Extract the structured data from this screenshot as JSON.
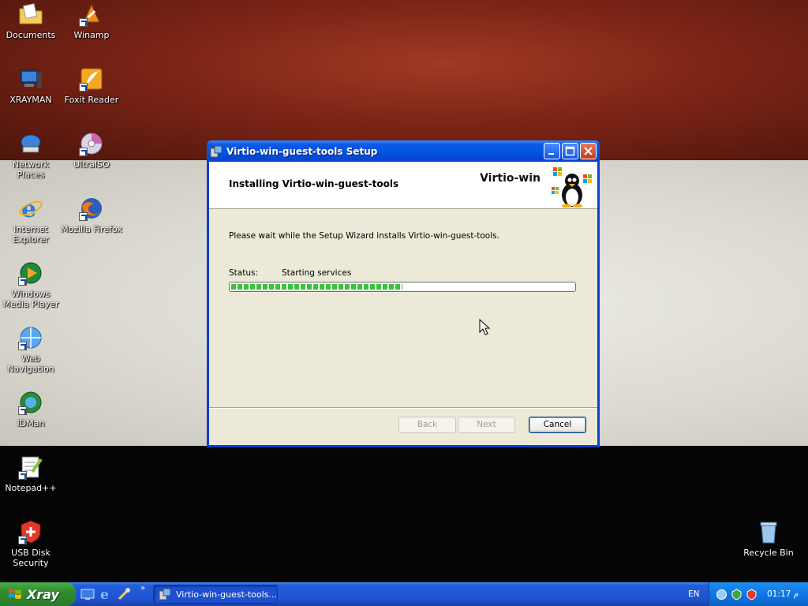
{
  "desktop": {
    "icons": [
      {
        "label": "Documents",
        "icon": "folder-documents-icon"
      },
      {
        "label": "Winamp",
        "icon": "winamp-icon"
      },
      {
        "label": "XRAYMAN",
        "icon": "computer-icon"
      },
      {
        "label": "Foxit Reader",
        "icon": "foxit-reader-icon"
      },
      {
        "label": "Network Places",
        "icon": "network-places-icon"
      },
      {
        "label": "UltraISO",
        "icon": "ultraiso-icon"
      },
      {
        "label": "Internet Explorer",
        "icon": "internet-explorer-icon"
      },
      {
        "label": "Mozilla Firefox",
        "icon": "firefox-icon"
      },
      {
        "label": "Windows Media Player",
        "icon": "media-player-icon"
      },
      {
        "label": "Web Navigation",
        "icon": "web-navigation-icon"
      },
      {
        "label": "IDMan",
        "icon": "idman-icon"
      },
      {
        "label": "Notepad++",
        "icon": "notepad-plus-plus-icon"
      },
      {
        "label": "USB Disk Security",
        "icon": "usb-disk-security-icon"
      },
      {
        "label": "Recycle Bin",
        "icon": "recycle-bin-icon"
      }
    ]
  },
  "window": {
    "title": "Virtio-win-guest-tools Setup",
    "banner_title": "Installing Virtio-win-guest-tools",
    "brand": "Virtio-win",
    "message": "Please wait while the Setup Wizard installs Virtio-win-guest-tools.",
    "status_label": "Status:",
    "status_value": "Starting services",
    "progress_fraction": 0.5,
    "buttons": {
      "back": "Back",
      "next": "Next",
      "cancel": "Cancel"
    }
  },
  "taskbar": {
    "start_label": "Xray",
    "more": "»",
    "task_label": "Virtio-win-guest-tools...",
    "language": "EN",
    "clock": "01:17 م"
  },
  "colors": {
    "title_bar": "#0052e0",
    "progress": "#37c43a",
    "start_button": "#318a30"
  }
}
